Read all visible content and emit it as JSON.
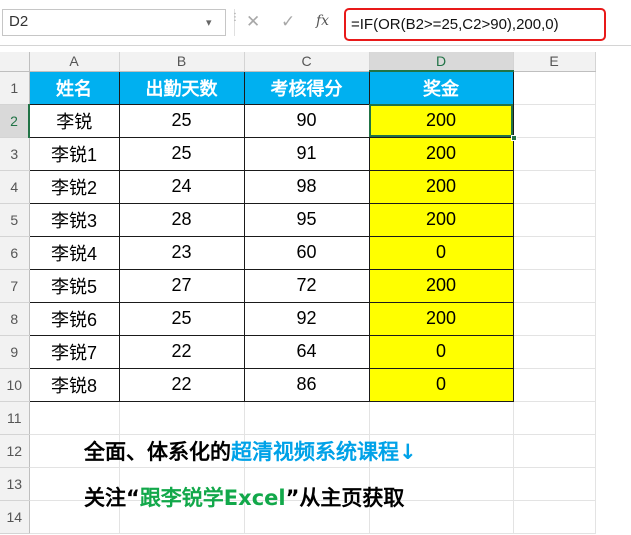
{
  "formula_bar": {
    "name_box": "D2",
    "formula": "=IF(OR(B2>=25,C2>90),200,0)",
    "icons": [
      "cancel-icon",
      "enter-icon",
      "function-icon"
    ]
  },
  "columns": [
    "A",
    "B",
    "C",
    "D",
    "E"
  ],
  "selected_column": "D",
  "rows": [
    "1",
    "2",
    "3",
    "4",
    "5",
    "6",
    "7",
    "8",
    "9",
    "10",
    "11",
    "12",
    "13",
    "14"
  ],
  "selected_row": "2",
  "table": {
    "headers": [
      "姓名",
      "出勤天数",
      "考核得分",
      "奖金"
    ],
    "records": [
      [
        "李锐",
        "25",
        "90",
        "200"
      ],
      [
        "李锐1",
        "25",
        "91",
        "200"
      ],
      [
        "李锐2",
        "24",
        "98",
        "200"
      ],
      [
        "李锐3",
        "28",
        "95",
        "200"
      ],
      [
        "李锐4",
        "23",
        "60",
        "0"
      ],
      [
        "李锐5",
        "27",
        "72",
        "200"
      ],
      [
        "李锐6",
        "25",
        "92",
        "200"
      ],
      [
        "李锐7",
        "22",
        "64",
        "0"
      ],
      [
        "李锐8",
        "22",
        "86",
        "0"
      ]
    ]
  },
  "colors": {
    "header_bg": "#00b0f0",
    "highlight": "#ffff00",
    "formula_border": "#e81919",
    "excel_green": "#217346"
  },
  "promo": {
    "line1_black": "全面、体系化的",
    "line1_blue": "超清视频系统课程↓",
    "line2_prefix": "关注“",
    "line2_green": "跟李锐学Excel",
    "line2_suffix": "”从主页获取"
  }
}
